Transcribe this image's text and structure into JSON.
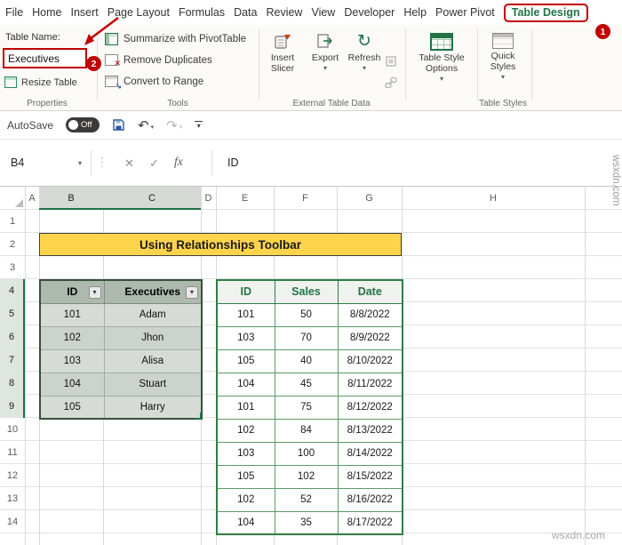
{
  "colors": {
    "accent_green": "#217346",
    "annotation_red": "#c00000",
    "title_yellow": "#ffd44d"
  },
  "menu": {
    "items": [
      "File",
      "Home",
      "Insert",
      "Page Layout",
      "Formulas",
      "Data",
      "Review",
      "View",
      "Developer",
      "Help",
      "Power Pivot"
    ],
    "active": "Table Design"
  },
  "ribbon": {
    "table_name_label": "Table Name:",
    "table_name_value": "Executives",
    "resize_table_label": "Resize Table",
    "properties_group_label": "Properties",
    "tools": {
      "summarize": "Summarize with PivotTable",
      "remove_duplicates": "Remove Duplicates",
      "convert_to_range": "Convert to Range",
      "group_label": "Tools"
    },
    "external": {
      "insert_slicer": "Insert Slicer",
      "export": "Export",
      "refresh": "Refresh",
      "group_label": "External Table Data"
    },
    "styles": {
      "table_style_options": "Table Style Options",
      "quick_styles": "Quick Styles",
      "group_label": "Table Styles"
    }
  },
  "quick_access": {
    "autosave_label": "AutoSave",
    "autosave_state": "Off"
  },
  "formula_bar": {
    "name_box": "B4",
    "fx_label": "fx",
    "value": "ID"
  },
  "icons": {
    "dropdown": "▾",
    "undo": "↶",
    "redo": "↷",
    "refresh": "↻",
    "cancel": "✕",
    "confirm": "✓",
    "dots": "⋮"
  },
  "annotations": {
    "step1": "1",
    "step2": "2"
  },
  "sheet": {
    "column_headers": [
      "A",
      "B",
      "C",
      "D",
      "E",
      "F",
      "G",
      "H"
    ],
    "row_headers": [
      "1",
      "2",
      "3",
      "4",
      "5",
      "6",
      "7",
      "8",
      "9",
      "10",
      "11",
      "12",
      "13",
      "14"
    ],
    "title": "Using Relationships Toolbar",
    "left_table": {
      "headers": [
        "ID",
        "Executives"
      ],
      "rows": [
        [
          "101",
          "Adam"
        ],
        [
          "102",
          "Jhon"
        ],
        [
          "103",
          "Alisa"
        ],
        [
          "104",
          "Stuart"
        ],
        [
          "105",
          "Harry"
        ]
      ]
    },
    "right_table": {
      "headers": [
        "ID",
        "Sales",
        "Date"
      ],
      "rows": [
        [
          "101",
          "50",
          "8/8/2022"
        ],
        [
          "103",
          "70",
          "8/9/2022"
        ],
        [
          "105",
          "40",
          "8/10/2022"
        ],
        [
          "104",
          "45",
          "8/11/2022"
        ],
        [
          "101",
          "75",
          "8/12/2022"
        ],
        [
          "102",
          "84",
          "8/13/2022"
        ],
        [
          "103",
          "100",
          "8/14/2022"
        ],
        [
          "105",
          "102",
          "8/15/2022"
        ],
        [
          "102",
          "52",
          "8/16/2022"
        ],
        [
          "104",
          "35",
          "8/17/2022"
        ]
      ]
    }
  },
  "watermark": {
    "side": "wsxdn.com",
    "bottom": "wsxdn.com"
  }
}
